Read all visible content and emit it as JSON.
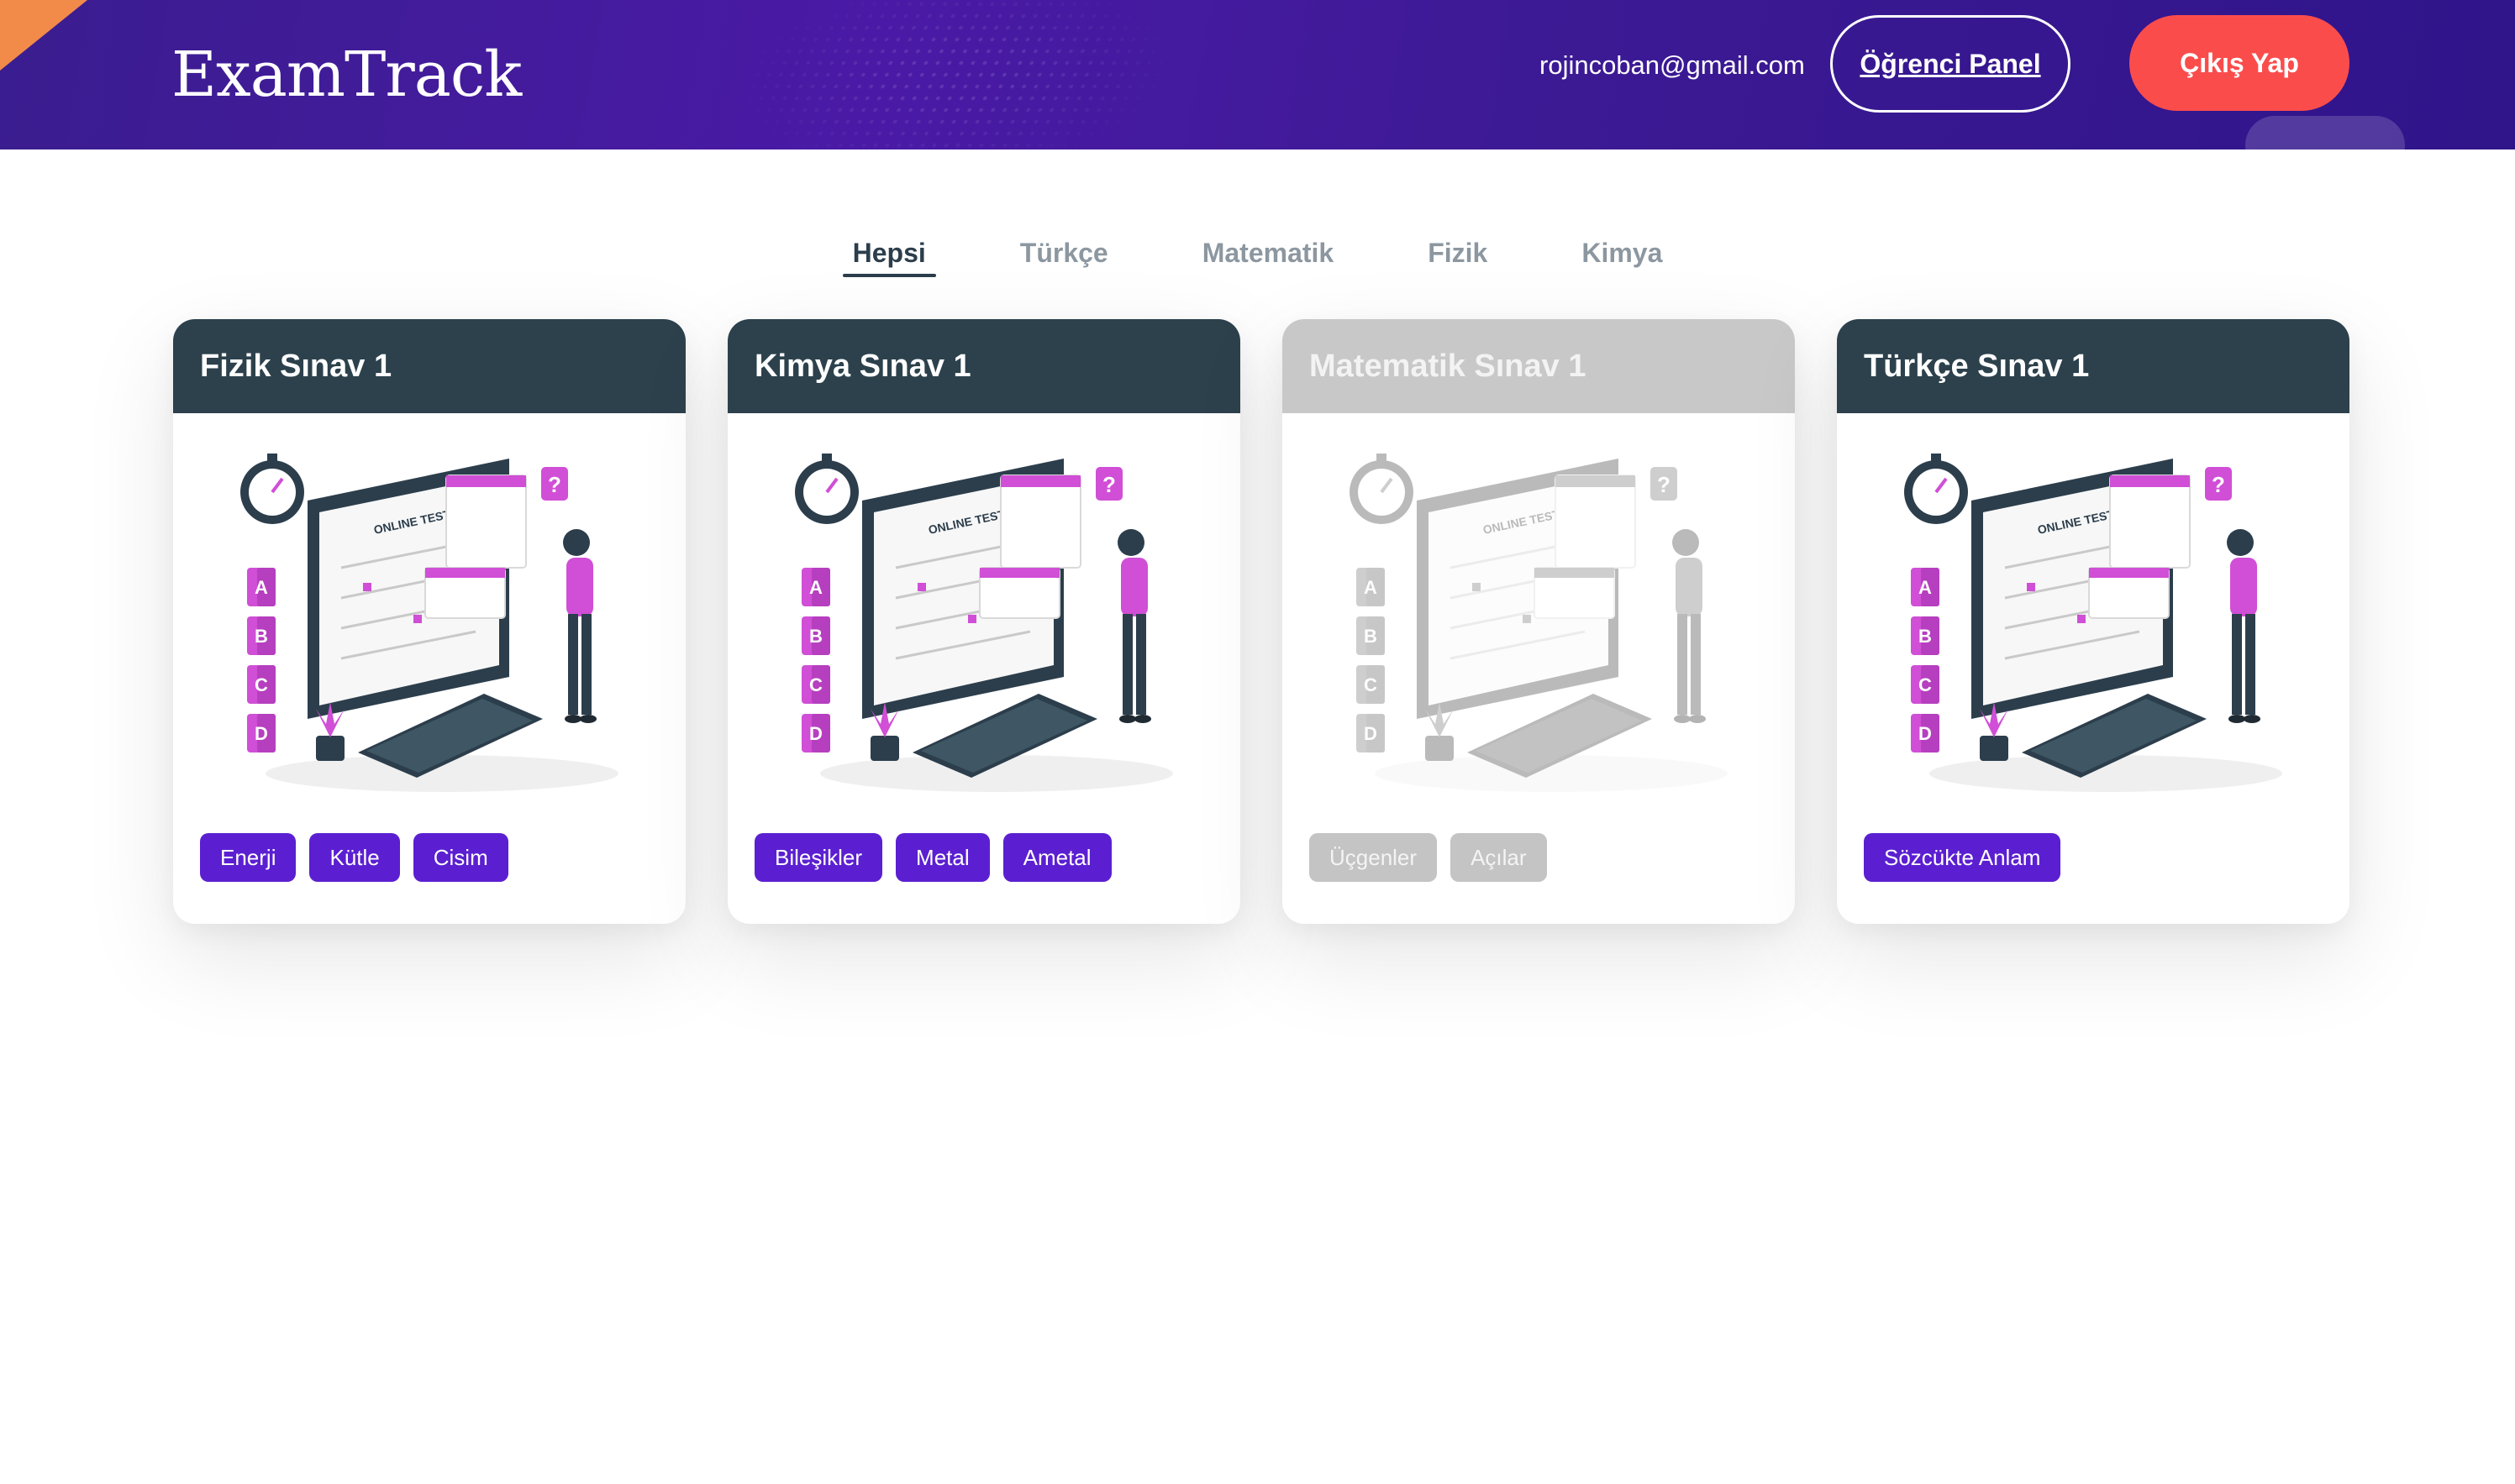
{
  "header": {
    "brand": "ExamTrack",
    "user_email": "rojincoban@gmail.com",
    "panel_button": "Öğrenci Panel",
    "logout_button": "Çıkış Yap"
  },
  "filters": {
    "tabs": [
      {
        "label": "Hepsi",
        "active": true
      },
      {
        "label": "Türkçe",
        "active": false
      },
      {
        "label": "Matematik",
        "active": false
      },
      {
        "label": "Fizik",
        "active": false
      },
      {
        "label": "Kimya",
        "active": false
      }
    ]
  },
  "exams": [
    {
      "title": "Fizik Sınav 1",
      "enabled": true,
      "tags": [
        "Enerji",
        "Kütle",
        "Cisim"
      ]
    },
    {
      "title": "Kimya Sınav 1",
      "enabled": true,
      "tags": [
        "Bileşikler",
        "Metal",
        "Ametal"
      ]
    },
    {
      "title": "Matematik Sınav 1",
      "enabled": false,
      "tags": [
        "Üçgenler",
        "Açılar"
      ]
    },
    {
      "title": "Türkçe Sınav 1",
      "enabled": true,
      "tags": [
        "Sözcükte Anlam"
      ]
    }
  ],
  "illustration": {
    "screen_text": "ONLINE TEST",
    "options": [
      "A",
      "B",
      "C",
      "D"
    ],
    "question_mark": "?"
  },
  "colors": {
    "header_bg": "#3f1a9b",
    "logout_bg": "#fb4c4c",
    "card_head": "#2c414c",
    "tag_bg": "#5b1fd1",
    "disabled": "#c8c8c8"
  }
}
